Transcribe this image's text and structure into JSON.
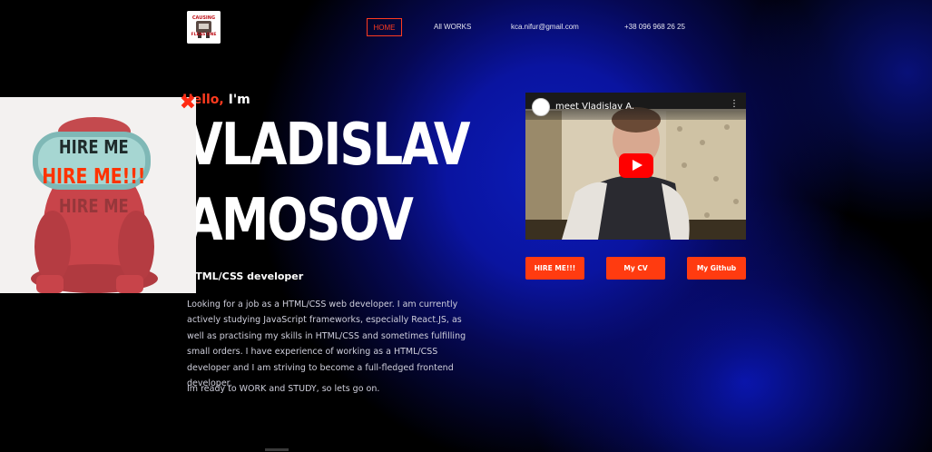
{
  "header": {
    "logo": {
      "text_top": "CAUSING",
      "text_bottom": "FLEAS ONE"
    },
    "nav": [
      {
        "label": "HOME",
        "active": true
      },
      {
        "label": "All WORKS"
      },
      {
        "label": "kca.nifur@gmail.com"
      },
      {
        "label": "+38 096 968 26 25"
      }
    ]
  },
  "hero": {
    "greeting_accent": "Hello,",
    "greeting_rest": "I'm",
    "name_line_1": "VLADISLAV",
    "name_line_2": "AMOSOV",
    "role": "HTML/CSS developer",
    "bio": "Looking for a job as a HTML/CSS web developer. I am currently actively studying JavaScript frameworks, especially React.JS, as well as practising my skills in HTML/CSS and sometimes fulfilling small orders. I have experience of working as a HTML/CSS developer and I am striving to become a full-fledged frontend developer.",
    "bio_2": "Im ready to WORK and STUDY, so lets go on."
  },
  "popup": {
    "text_1": "HIRE ME",
    "text_2": "HIRE ME!!!",
    "text_3": "HIRE ME",
    "close_glyph": "✖"
  },
  "video": {
    "title": "meet Vladislav A.",
    "menu_glyph": "⋮"
  },
  "buttons": {
    "hire": "HIRE ME!!!",
    "cv": "My CV",
    "github": "My Github"
  },
  "colors": {
    "accent": "#ff3b1f",
    "button": "#ff3b10",
    "background": "#000000",
    "glow": "#0c1cb8"
  },
  "icons": [
    "close-icon",
    "play-icon",
    "more-vert-icon"
  ]
}
